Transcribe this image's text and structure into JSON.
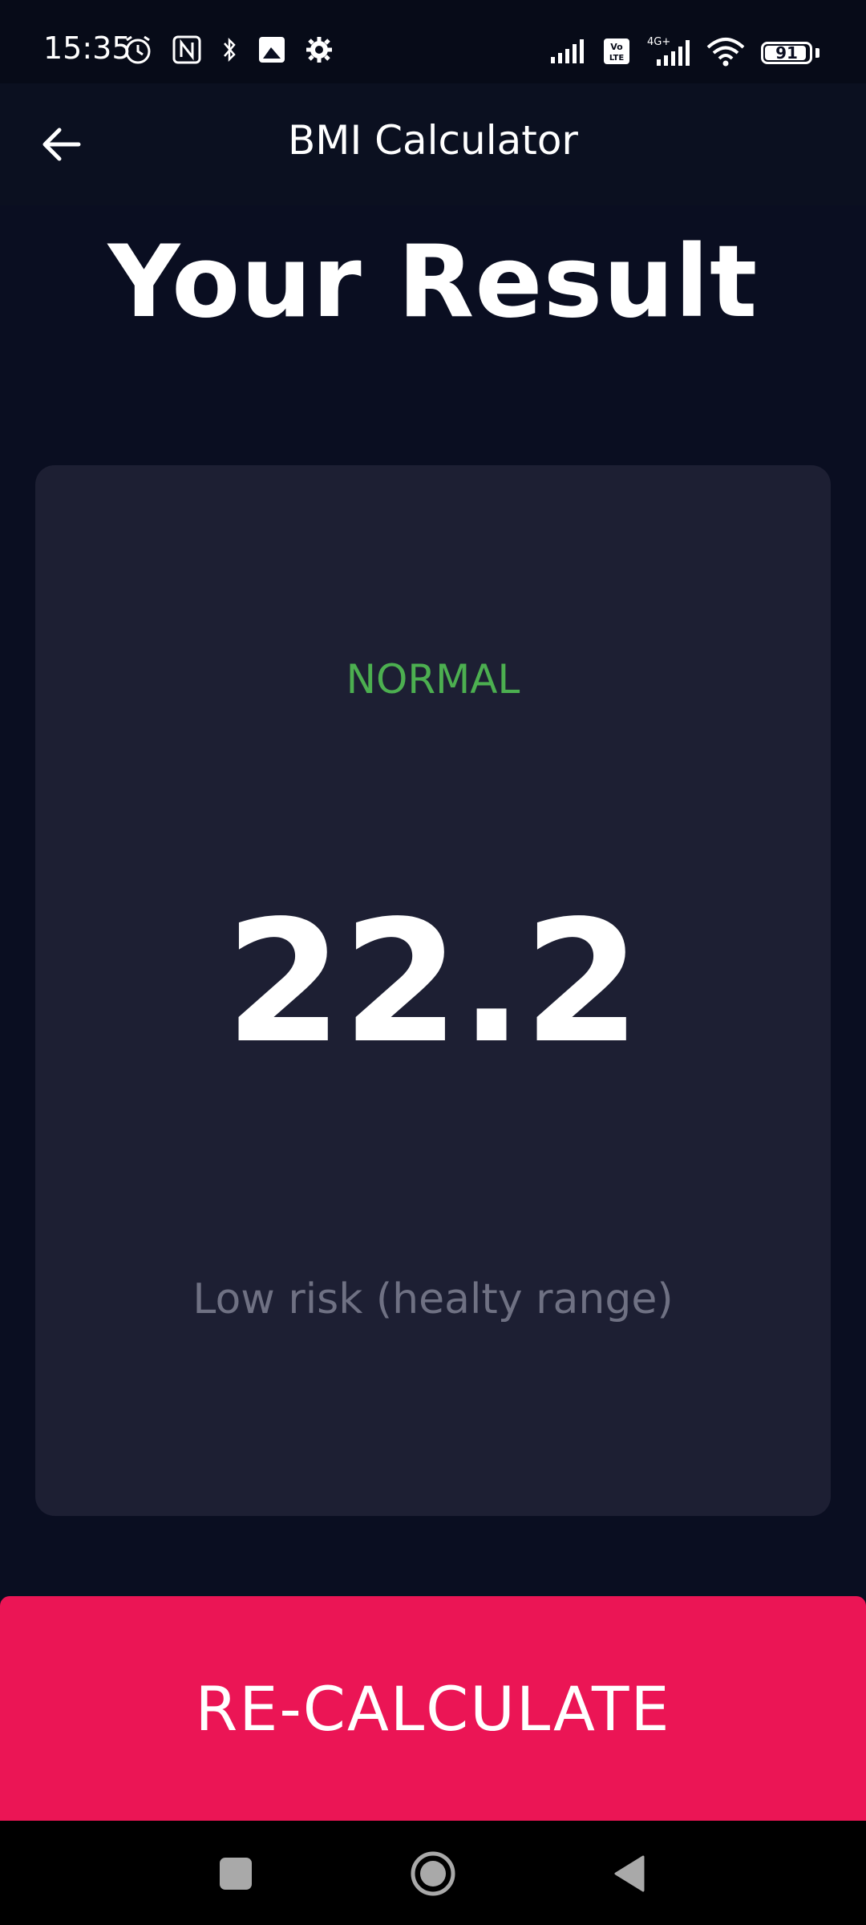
{
  "status_bar": {
    "time": "15:35",
    "battery_level": "91",
    "network": "4G+",
    "volte": "Vo LTE"
  },
  "app_bar": {
    "title": "BMI Calculator",
    "back_icon": "arrow-left-icon"
  },
  "result": {
    "heading": "Your Result",
    "status": "NORMAL",
    "bmi": "22.2",
    "interpretation": "Low risk (healty range)"
  },
  "action": {
    "button_label": "RE-CALCULATE"
  },
  "colors": {
    "background": "#0a0e21",
    "card": "#1d1f33",
    "status_normal": "#4caf50",
    "accent": "#eb1555",
    "muted_text": "#6f7183"
  },
  "nav_bar": {
    "icons": [
      "recent-apps-icon",
      "home-icon",
      "back-icon"
    ]
  }
}
